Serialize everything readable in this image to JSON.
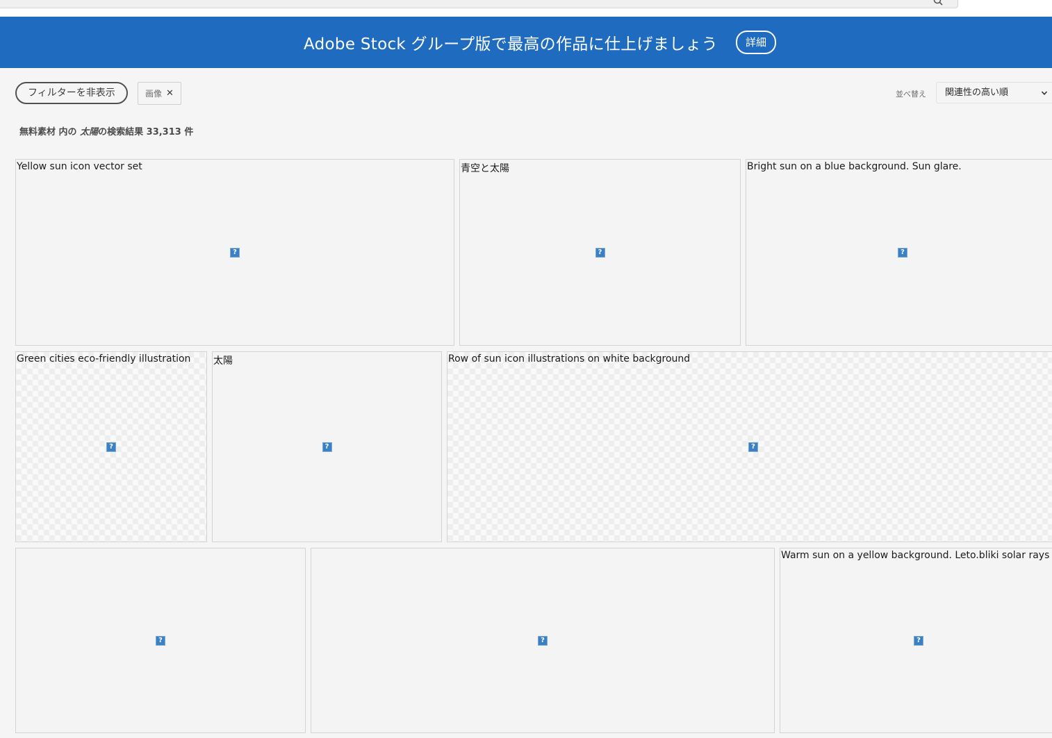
{
  "banner": {
    "text": "Adobe Stock グループ版で最高の作品に仕上げましょう",
    "button_label": "詳細",
    "color": "#1e6bbf"
  },
  "filters": {
    "hide_filter_label": "フィルターを非表示",
    "chip_label": "画像",
    "chip_remove": "✕"
  },
  "sort": {
    "label": "並べ替え",
    "selected": "関連性の高い順"
  },
  "results": {
    "collection": "無料素材",
    "in": "内の",
    "query": "太陽",
    "of_results": "の検索結果",
    "count": "33,313",
    "unit": "件"
  },
  "broken_image_glyph": "?",
  "tiles": [
    {
      "caption": "Yellow sun icon vector set"
    },
    {
      "caption": "青空と太陽"
    },
    {
      "caption": "Bright sun on a blue background. Sun glare."
    },
    {
      "caption": "Green cities eco-friendly illustration"
    },
    {
      "caption": "太陽"
    },
    {
      "caption": "Row of sun icon illustrations on white background"
    },
    {
      "caption": ""
    },
    {
      "caption": ""
    },
    {
      "caption": "Warm sun on a yellow background. Leto.bliki solar rays"
    }
  ]
}
